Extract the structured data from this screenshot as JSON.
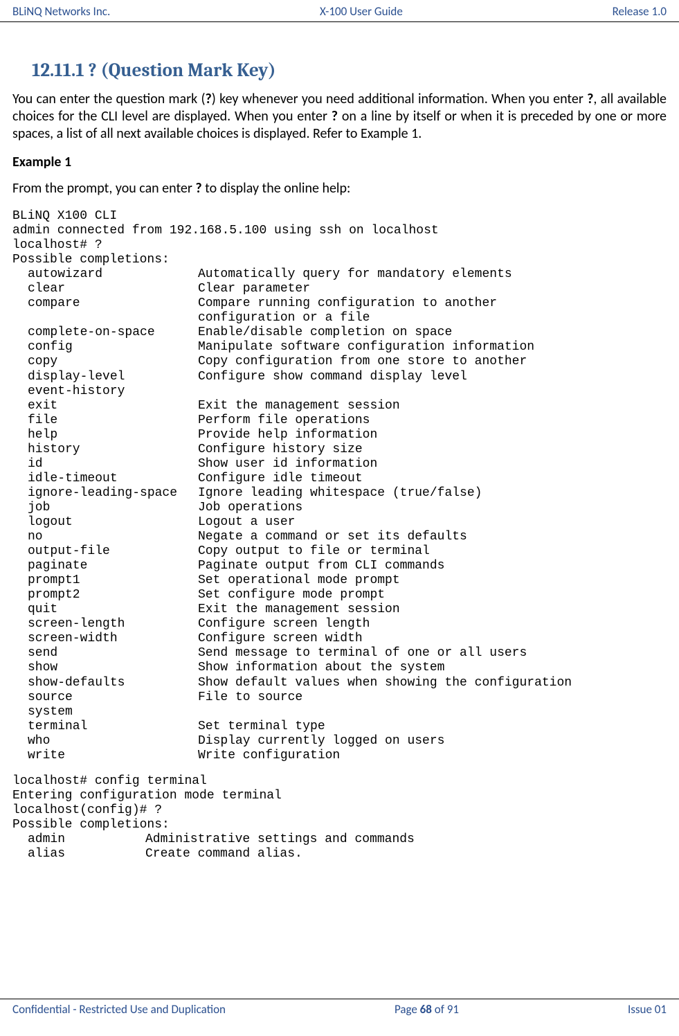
{
  "header": {
    "left": "BLiNQ Networks Inc.",
    "center": "X-100 User Guide",
    "right": "Release 1.0"
  },
  "section": {
    "number": "12.11.1",
    "title": "? (Question Mark Key)"
  },
  "intro": {
    "part1": "You can enter the question mark (",
    "q1": "?",
    "part2": ") key whenever you need additional information. When you enter ",
    "q2": "?",
    "part3": ", all available choices for the CLI level are displayed. When you enter ",
    "q3": "?",
    "part4": " on a line by itself or when it is preceded by one or more spaces, a list of all next available choices is displayed. Refer to Example 1."
  },
  "example_label": "Example 1",
  "prompt_intro": {
    "part1": "From the prompt, you can enter ",
    "q": "?",
    "part2": " to display the online help:"
  },
  "cli_block1": {
    "lines_pre": [
      "BLiNQ X100 CLI",
      "admin connected from 192.168.5.100 using ssh on localhost",
      "localhost# ?",
      "Possible completions:"
    ],
    "items": [
      {
        "cmd": "autowizard",
        "desc": "Automatically query for mandatory elements"
      },
      {
        "cmd": "clear",
        "desc": "Clear parameter"
      },
      {
        "cmd": "compare",
        "desc": "Compare running configuration to another"
      },
      {
        "cmd": "",
        "desc": "configuration or a file"
      },
      {
        "cmd": "complete-on-space",
        "desc": "Enable/disable completion on space"
      },
      {
        "cmd": "config",
        "desc": "Manipulate software configuration information"
      },
      {
        "cmd": "copy",
        "desc": "Copy configuration from one store to another"
      },
      {
        "cmd": "display-level",
        "desc": "Configure show command display level"
      },
      {
        "cmd": "event-history",
        "desc": ""
      },
      {
        "cmd": "exit",
        "desc": "Exit the management session"
      },
      {
        "cmd": "file",
        "desc": "Perform file operations"
      },
      {
        "cmd": "help",
        "desc": "Provide help information"
      },
      {
        "cmd": "history",
        "desc": "Configure history size"
      },
      {
        "cmd": "id",
        "desc": "Show user id information"
      },
      {
        "cmd": "idle-timeout",
        "desc": "Configure idle timeout"
      },
      {
        "cmd": "ignore-leading-space",
        "desc": "Ignore leading whitespace (true/false)"
      },
      {
        "cmd": "job",
        "desc": "Job operations"
      },
      {
        "cmd": "logout",
        "desc": "Logout a user"
      },
      {
        "cmd": "no",
        "desc": "Negate a command or set its defaults"
      },
      {
        "cmd": "output-file",
        "desc": "Copy output to file or terminal"
      },
      {
        "cmd": "paginate",
        "desc": "Paginate output from CLI commands"
      },
      {
        "cmd": "prompt1",
        "desc": "Set operational mode prompt"
      },
      {
        "cmd": "prompt2",
        "desc": "Set configure mode prompt"
      },
      {
        "cmd": "quit",
        "desc": "Exit the management session"
      },
      {
        "cmd": "screen-length",
        "desc": "Configure screen length"
      },
      {
        "cmd": "screen-width",
        "desc": "Configure screen width"
      },
      {
        "cmd": "send",
        "desc": "Send message to terminal of one or all users"
      },
      {
        "cmd": "show",
        "desc": "Show information about the system"
      },
      {
        "cmd": "show-defaults",
        "desc": "Show default values when showing the configuration"
      },
      {
        "cmd": "source",
        "desc": "File to source"
      },
      {
        "cmd": "system",
        "desc": ""
      },
      {
        "cmd": "terminal",
        "desc": "Set terminal type"
      },
      {
        "cmd": "who",
        "desc": "Display currently logged on users"
      },
      {
        "cmd": "write",
        "desc": "Write configuration"
      }
    ]
  },
  "cli_block2": {
    "lines_pre": [
      "localhost# config terminal",
      "Entering configuration mode terminal",
      "localhost(config)# ?",
      "Possible completions:"
    ],
    "items": [
      {
        "cmd": "admin",
        "desc": "Administrative settings and commands"
      },
      {
        "cmd": "alias",
        "desc": "Create command alias."
      }
    ]
  },
  "footer": {
    "left": "Confidential - Restricted Use and Duplication",
    "center_prefix": "Page ",
    "page_current": "68",
    "center_mid": " of ",
    "page_total": "91",
    "right": "Issue 01"
  }
}
